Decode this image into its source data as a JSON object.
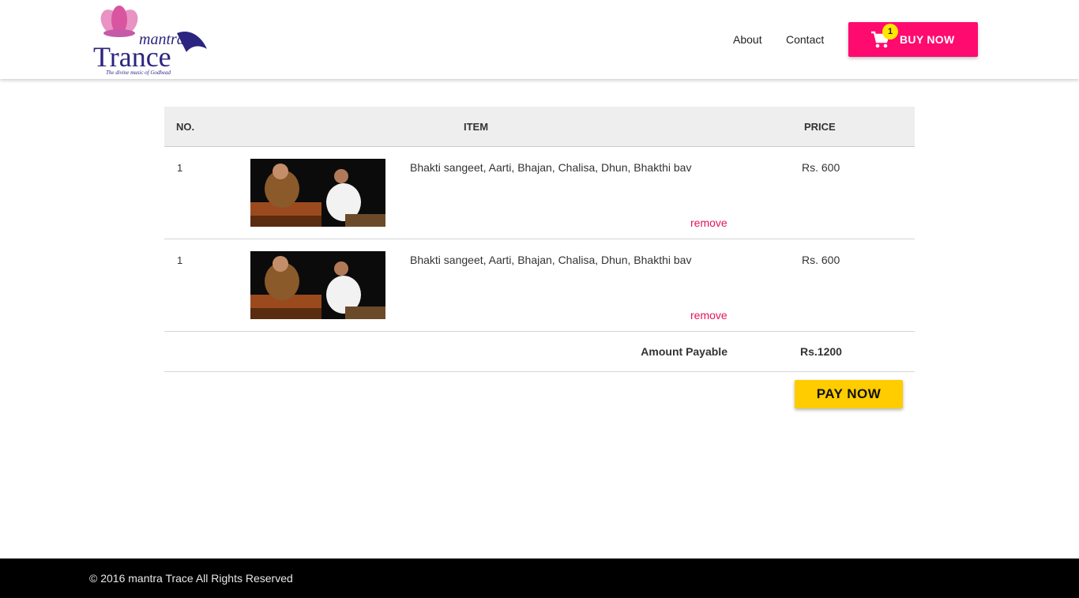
{
  "brand": {
    "logo_word1": "mantra",
    "logo_word2": "Trance",
    "tagline": "The divine music of Godhead"
  },
  "nav": {
    "about": "About",
    "contact": "Contact"
  },
  "cart_button": {
    "label": "BUY NOW",
    "count": "1",
    "icon": "shopping-cart-icon",
    "color": "#ff0a6e"
  },
  "table": {
    "headers": {
      "no": "NO.",
      "item": "ITEM",
      "price": "PRICE"
    },
    "rows": [
      {
        "no": "1",
        "title": "Bhakti sangeet, Aarti, Bhajan, Chalisa, Dhun, Bhakthi bav",
        "remove": "remove",
        "price": "Rs. 600"
      },
      {
        "no": "1",
        "title": "Bhakti sangeet, Aarti, Bhajan, Chalisa, Dhun, Bhakthi bav",
        "remove": "remove",
        "price": "Rs. 600"
      }
    ],
    "total_label": "Amount Payable",
    "total_value": "Rs.1200"
  },
  "pay_button": {
    "label": "PAY NOW",
    "color": "#ffcc00"
  },
  "footer": {
    "copyright": "© 2016 mantra Trace All Rights Reserved"
  }
}
